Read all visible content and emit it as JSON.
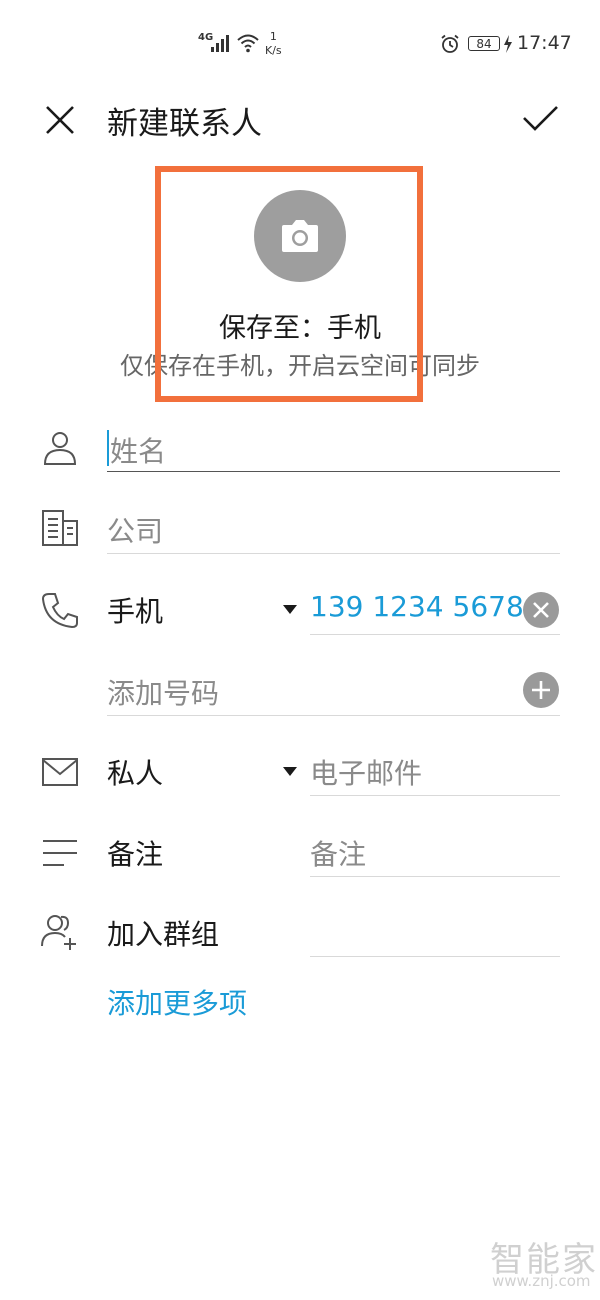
{
  "status_bar": {
    "network": "4G",
    "speed_value": "1",
    "speed_unit": "K/s",
    "battery": "84",
    "time": "17:47"
  },
  "app_bar": {
    "title": "新建联系人",
    "close_icon": "close-icon",
    "confirm_icon": "check-icon"
  },
  "photo": {
    "camera_icon": "camera-icon",
    "save_to": "保存至：手机",
    "hint": "仅保存在手机，开启云空间可同步"
  },
  "form": {
    "name_placeholder": "姓名",
    "company_placeholder": "公司",
    "phone_label": "手机",
    "phone_value": "139 1234 5678",
    "add_number": "添加号码",
    "email_label": "私人",
    "email_placeholder": "电子邮件",
    "note_label": "备注",
    "note_placeholder": "备注",
    "group_label": "加入群组",
    "add_more": "添加更多项"
  },
  "colors": {
    "accent": "#1a9bd7",
    "highlight": "#f2703c",
    "icon_gray": "#9e9e9e"
  },
  "watermark": {
    "text": "智能家",
    "url": "www.znj.com"
  }
}
